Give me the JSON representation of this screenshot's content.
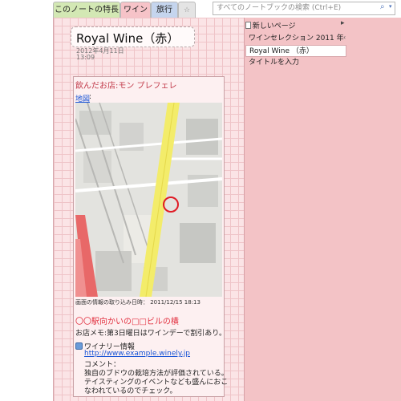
{
  "tabs": {
    "notebook": "このノートの特長",
    "wine": "ワイン",
    "travel": "旅行",
    "new_tab": "☆"
  },
  "search": {
    "placeholder": "すべてのノートブックの検索 (Ctrl+E)"
  },
  "note": {
    "title": "Royal Wine（赤）",
    "date": "2012年4月11日",
    "time": "13:09",
    "shop_name": "飲んだお店:モン プレフェレ",
    "map_link": "地図",
    "map_colon": ":",
    "map_caption": "画面の情報の取り込み日時： 2011/12/15 18:13",
    "station": "〇〇駅向かいの□□ビルの横",
    "shop_memo": "お店メモ:第3日曜日はワインデーで割引あり。",
    "winery_label": "ワイナリー情報",
    "winery_url": "http://www.example.winely.jp",
    "comment_label": "コメント：",
    "comment_lines": [
      "独自のブドウの栽培方法が評価されている。",
      "テイスティングのイベントなども盛んにおこ",
      "なわれているのでチェック。"
    ]
  },
  "pages_panel": {
    "new_page": "新しいページ",
    "new_page_arrow": "▸",
    "items": [
      "ワインセレクション 2011 年",
      "Royal Wine （赤）",
      "タイトルを入力"
    ],
    "item_arrow": "‹"
  },
  "colors": {
    "page_background": "#fbe4e6",
    "panel_background": "#f3c3c6",
    "accent_red": "#c23b4b",
    "link_blue": "#1a55d6",
    "map_road_yellow": "#f3ec6a",
    "map_marker": "#e01b25"
  },
  "icons": {
    "search": "magnifier",
    "new_page": "document",
    "winery": "globe"
  }
}
